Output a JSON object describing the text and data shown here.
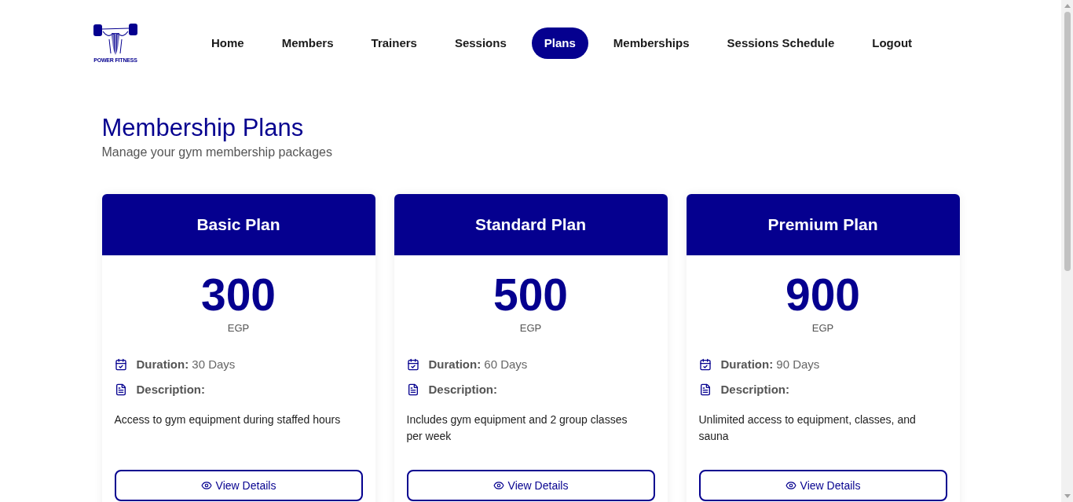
{
  "logo": {
    "text": "POWER FITNESS"
  },
  "nav": [
    {
      "label": "Home",
      "selected": false
    },
    {
      "label": "Members",
      "selected": false
    },
    {
      "label": "Trainers",
      "selected": false
    },
    {
      "label": "Sessions",
      "selected": false
    },
    {
      "label": "Plans",
      "selected": true
    },
    {
      "label": "Memberships",
      "selected": false
    },
    {
      "label": "Sessions Schedule",
      "selected": false
    },
    {
      "label": "Logout",
      "selected": false
    }
  ],
  "header": {
    "title": "Membership Plans",
    "subtitle": "Manage your gym membership packages"
  },
  "plans": [
    {
      "name": "Basic Plan",
      "price": "300",
      "currency": "EGP",
      "duration": "**Duration:** 30 Days",
      "description_label": "Description:",
      "description": "Access to gym equipment during staffed hours",
      "button": "View Details"
    },
    {
      "name": "Standard Plan",
      "price": "500",
      "currency": "EGP",
      "duration": "**Duration:** 60 Days",
      "description_label": "Description:",
      "description": "Includes gym equipment and 2 group classes per week",
      "button": "View Details"
    },
    {
      "name": "Premium Plan",
      "price": "900",
      "currency": "EGP",
      "duration": "**Duration:** 90 Days",
      "description_label": "Description:",
      "description": "Unlimited access to equipment, classes, and sauna",
      "button": "View Details"
    }
  ]
}
